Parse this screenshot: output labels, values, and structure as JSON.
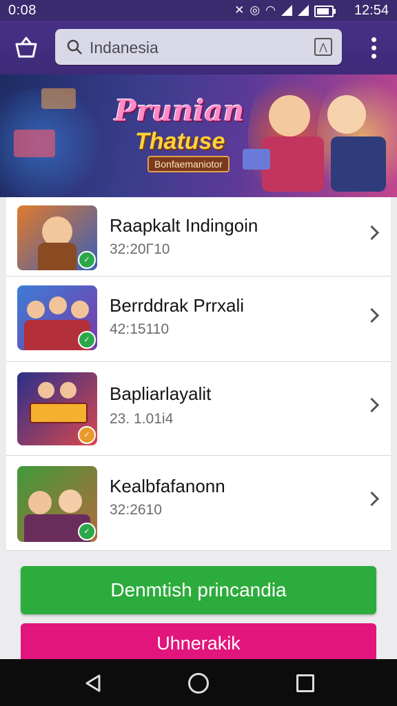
{
  "status_bar": {
    "time_left": "0:08",
    "time_right": "12:54"
  },
  "app_bar": {
    "search_text": "Indanesia",
    "icons": [
      "basket-icon",
      "search-icon",
      "scan-icon",
      "more-vert-icon"
    ]
  },
  "banner": {
    "title_line1": "Prunian",
    "title_line2": "Thatuse",
    "subtitle": "Bonfaemaniotor"
  },
  "games": [
    {
      "title": "Raapkalt Indingoin",
      "subtitle": "32:20Γ10",
      "thumb_colors": [
        "#e07a2c",
        "#3b5fb8"
      ],
      "badge_color": "#2ba84a"
    },
    {
      "title": "Berrddrak Prrxali",
      "subtitle": "42:15110",
      "thumb_colors": [
        "#3d7dd6",
        "#7a3aa8"
      ],
      "badge_color": "#2ba84a"
    },
    {
      "title": "Bapliarlayalit",
      "subtitle": "23. 1.01i4",
      "thumb_colors": [
        "#2a2f8a",
        "#d8484e"
      ],
      "badge_color": "#e89a2a"
    },
    {
      "title": "Kealbfafanonn",
      "subtitle": "32:2610",
      "thumb_colors": [
        "#3f9a3a",
        "#b36a3c"
      ],
      "badge_color": "#2ba84a"
    }
  ],
  "buttons": {
    "primary": "Denmtish princandia",
    "secondary": "Uhnerakik"
  },
  "colors": {
    "app_bar": "#3d2a78",
    "primary_button": "#2cac3c",
    "secondary_button": "#e2157c"
  }
}
